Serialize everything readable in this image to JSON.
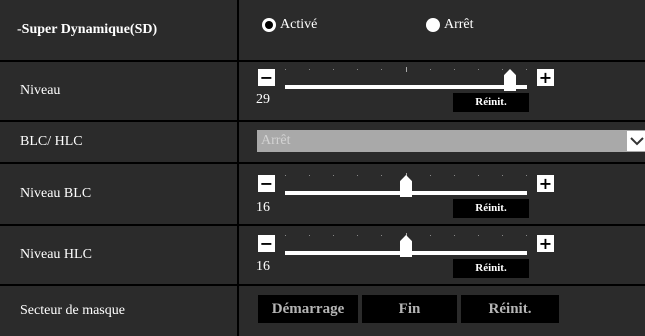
{
  "rows": [
    {
      "label": "-Super Dynamique(SD)"
    },
    {
      "label": "Niveau"
    },
    {
      "label": "BLC/ HLC"
    },
    {
      "label": "Niveau BLC"
    },
    {
      "label": "Niveau HLC"
    },
    {
      "label": "Secteur de masque"
    }
  ],
  "super_dynamique": {
    "options": [
      "Activé",
      "Arrêt"
    ],
    "selected": "Activé"
  },
  "niveau": {
    "value": "29",
    "level_fraction": 0.93,
    "minus": "−",
    "plus": "+",
    "reset_label": "Réinit."
  },
  "blc_hlc": {
    "selected": "Arrêt"
  },
  "niveau_blc": {
    "value": "16",
    "level_fraction": 0.5,
    "minus": "−",
    "plus": "+",
    "reset_label": "Réinit."
  },
  "niveau_hlc": {
    "value": "16",
    "level_fraction": 0.5,
    "minus": "−",
    "plus": "+",
    "reset_label": "Réinit."
  },
  "secteur_masque": {
    "start_label": "Démarrage",
    "end_label": "Fin",
    "reset_label": "Réinit."
  },
  "colors": {
    "row_bg": "#2b2b2b",
    "separator": "#000000",
    "select_bg": "#a9a9a9",
    "select_text": "#d3d3d3"
  }
}
